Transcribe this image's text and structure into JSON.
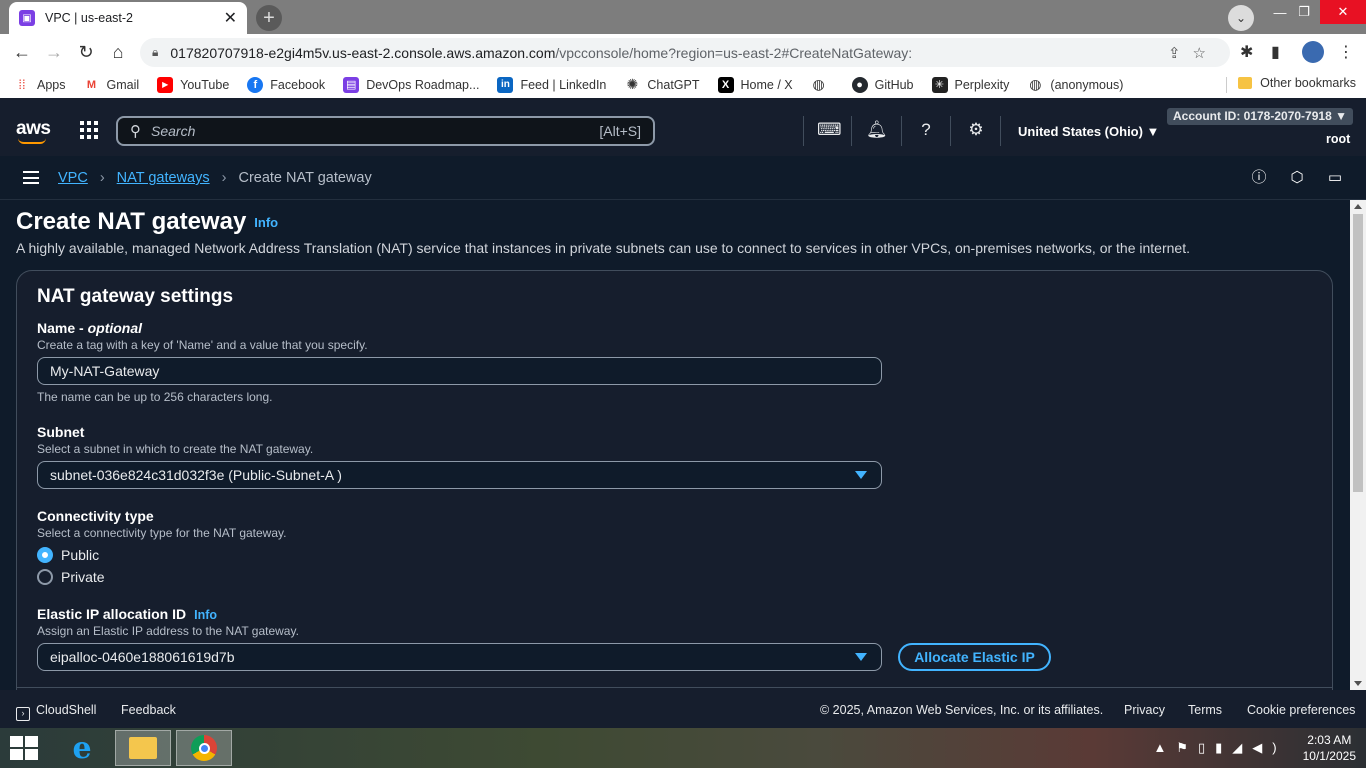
{
  "browser": {
    "tab_title": "VPC | us-east-2",
    "url_host": "017820707918-e2gi4m5v.us-east-2.console.aws.amazon.com",
    "url_rest": "/vpcconsole/home?region=us-east-2#CreateNatGateway:",
    "bookmarks": [
      "Apps",
      "Gmail",
      "YouTube",
      "Facebook",
      "DevOps Roadmap...",
      "Feed | LinkedIn",
      "ChatGPT",
      "Home / X",
      "",
      "GitHub",
      "Perplexity",
      "(anonymous)"
    ],
    "other_bookmarks": "Other bookmarks"
  },
  "aws_header": {
    "logo": "aws",
    "search_placeholder": "Search",
    "search_shortcut": "[Alt+S]",
    "region": "United States (Ohio) ▼",
    "account": "Account ID: 0178-2070-7918 ▼",
    "user": "root"
  },
  "breadcrumb": {
    "items": [
      "VPC",
      "NAT gateways",
      "Create NAT gateway"
    ]
  },
  "page": {
    "title": "Create NAT gateway",
    "info": "Info",
    "description": "A highly available, managed Network Address Translation (NAT) service that instances in private subnets can use to connect to services in other VPCs, on-premises networks, or the internet."
  },
  "settings": {
    "heading": "NAT gateway settings",
    "name": {
      "label": "Name",
      "optional": "optional",
      "description": "Create a tag with a key of 'Name' and a value that you specify.",
      "value": "My-NAT-Gateway",
      "hint": "The name can be up to 256 characters long."
    },
    "subnet": {
      "label": "Subnet",
      "description": "Select a subnet in which to create the NAT gateway.",
      "value": "subnet-036e824c31d032f3e (Public-Subnet-A )"
    },
    "connectivity": {
      "label": "Connectivity type",
      "description": "Select a connectivity type for the NAT gateway.",
      "options": [
        "Public",
        "Private"
      ],
      "selected": "Public"
    },
    "eip": {
      "label": "Elastic IP allocation ID",
      "info": "Info",
      "description": "Assign an Elastic IP address to the NAT gateway.",
      "value": "eipalloc-0460e188061619d7b",
      "allocate_button": "Allocate Elastic IP"
    }
  },
  "footer": {
    "cloudshell": "CloudShell",
    "feedback": "Feedback",
    "copyright": "© 2025, Amazon Web Services, Inc. or its affiliates.",
    "privacy": "Privacy",
    "terms": "Terms",
    "cookie": "Cookie preferences"
  },
  "taskbar": {
    "time": "2:03 AM",
    "date": "10/1/2025"
  },
  "colors": {
    "accent": "#42b4ff",
    "aws_orange": "#ff9900",
    "bg": "#0f1b2a"
  }
}
